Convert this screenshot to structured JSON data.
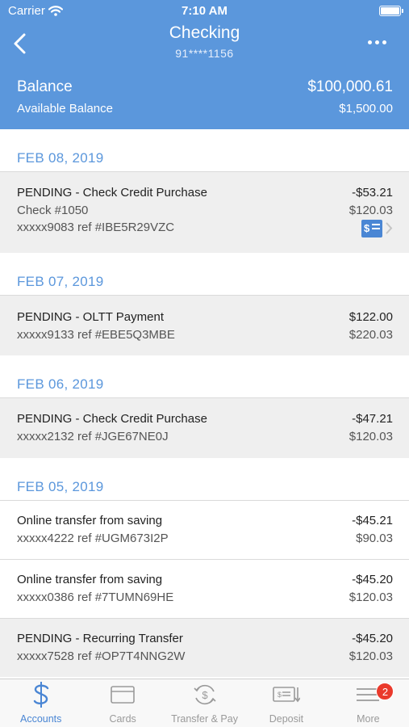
{
  "status_bar": {
    "carrier": "Carrier",
    "time": "7:10 AM"
  },
  "header": {
    "title": "Checking",
    "account_number": "91****1156"
  },
  "balance": {
    "label": "Balance",
    "value": "$100,000.61",
    "available_label": "Available Balance",
    "available_value": "$1,500.00"
  },
  "groups": [
    {
      "date": "FEB 08, 2019",
      "transactions": [
        {
          "pending": true,
          "title": "PENDING - Check Credit Purchase",
          "lines": [
            "Check #1050",
            "xxxxx9083 ref #IBE5R29VZC"
          ],
          "amount": "-$53.21",
          "balance": "$120.03",
          "has_check": true
        }
      ]
    },
    {
      "date": "FEB 07, 2019",
      "transactions": [
        {
          "pending": true,
          "title": "PENDING - OLTT Payment",
          "lines": [
            "xxxxx9133 ref #EBE5Q3MBE"
          ],
          "amount": "$122.00",
          "balance": "$220.03"
        }
      ]
    },
    {
      "date": "FEB 06, 2019",
      "transactions": [
        {
          "pending": true,
          "title": "PENDING - Check Credit Purchase",
          "lines": [
            "xxxxx2132 ref #JGE67NE0J"
          ],
          "amount": "-$47.21",
          "balance": "$120.03"
        }
      ]
    },
    {
      "date": "FEB 05, 2019",
      "transactions": [
        {
          "pending": false,
          "title": "Online transfer from saving",
          "lines": [
            "xxxxx4222 ref #UGM673I2P"
          ],
          "amount": "-$45.21",
          "balance": "$90.03"
        },
        {
          "pending": false,
          "title": "Online transfer from saving",
          "lines": [
            "xxxxx0386 ref #7TUMN69HE"
          ],
          "amount": "-$45.20",
          "balance": "$120.03"
        },
        {
          "pending": true,
          "title": "PENDING - Recurring Transfer",
          "lines": [
            "xxxxx7528 ref #OP7T4NNG2W"
          ],
          "amount": "-$45.20",
          "balance": "$120.03"
        }
      ]
    }
  ],
  "tabs": [
    {
      "label": "Accounts",
      "icon": "dollar-icon",
      "active": true
    },
    {
      "label": "Cards",
      "icon": "card-icon",
      "active": false
    },
    {
      "label": "Transfer & Pay",
      "icon": "transfer-icon",
      "active": false
    },
    {
      "label": "Deposit",
      "icon": "deposit-icon",
      "active": false
    },
    {
      "label": "More",
      "icon": "menu-icon",
      "active": false,
      "badge": "2"
    }
  ],
  "colors": {
    "accent": "#5b97dc",
    "pending_bg": "#efefef",
    "badge": "#ea3a2c"
  }
}
